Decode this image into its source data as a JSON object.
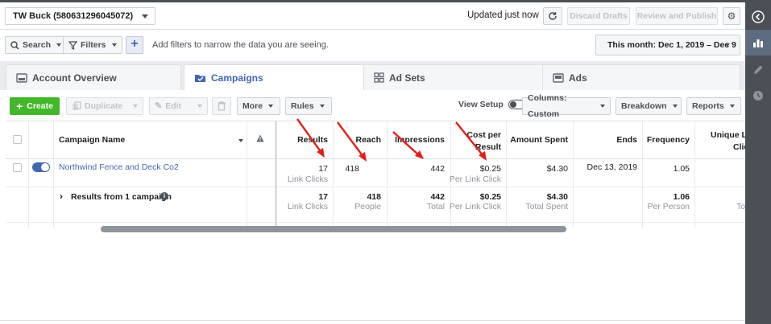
{
  "account": {
    "name": "TW Buck (580631296045072)"
  },
  "header": {
    "updated": "Updated just now",
    "discard": "Discard Drafts",
    "review": "Review and Publish"
  },
  "filters": {
    "search": "Search",
    "filters": "Filters",
    "hint": "Add filters to narrow the data you are seeing.",
    "date": "This month: Dec 1, 2019 – Dec 9"
  },
  "tabs": [
    {
      "label": "Account Overview"
    },
    {
      "label": "Campaigns"
    },
    {
      "label": "Ad Sets"
    },
    {
      "label": "Ads"
    }
  ],
  "toolbar": {
    "create": "Create",
    "duplicate": "Duplicate",
    "edit": "Edit",
    "more": "More",
    "rules": "Rules",
    "view_setup": "View Setup",
    "columns": "Columns: Custom",
    "breakdown": "Breakdown",
    "reports": "Reports"
  },
  "table": {
    "headers": {
      "name": "Campaign Name",
      "results": "Results",
      "reach": "Reach",
      "impressions": "Impressions",
      "cpr_line1": "Cost per",
      "cpr_line2": "Result",
      "spent": "Amount Spent",
      "ends": "Ends",
      "frequency": "Frequency",
      "unique_line1": "Unique Li",
      "unique_line2": "Clic"
    },
    "row": {
      "name": "Northwind Fence and Deck Co2",
      "results": "17",
      "results_sub": "Link Clicks",
      "reach": "418",
      "impressions": "442",
      "cpr": "$0.25",
      "cpr_sub": "Per Link Click",
      "spent": "$4.30",
      "ends": "Dec 13, 2019",
      "frequency": "1.05"
    },
    "summary": {
      "label": "Results from 1 campaign",
      "results": "17",
      "results_sub": "Link Clicks",
      "reach": "418",
      "reach_sub": "People",
      "impressions": "442",
      "impressions_sub": "Total",
      "cpr": "$0.25",
      "cpr_sub": "Per Link Click",
      "spent": "$4.30",
      "spent_sub": "Total Spent",
      "frequency": "1.06",
      "frequency_sub": "Per Person",
      "unique_sub": "To"
    }
  },
  "colors": {
    "accent": "#4267b2",
    "create_green": "#42b72a",
    "arrow_red": "#e0201b",
    "sidebar": "#4b4f56"
  }
}
